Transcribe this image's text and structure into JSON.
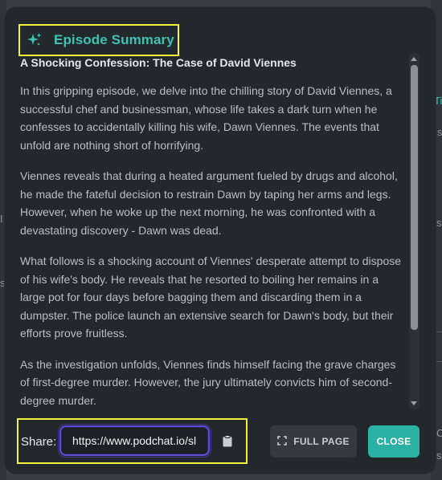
{
  "background": {
    "fragments": [
      "s",
      "I",
      "s",
      "s",
      "C",
      "Ti",
      "s"
    ]
  },
  "modal": {
    "title": "Episode Summary",
    "title_icon": "sparkles-icon",
    "content_title": "A Shocking Confession: The Case of David Viennes",
    "paragraphs": [
      "In this gripping episode, we delve into the chilling story of David Viennes, a successful chef and businessman, whose life takes a dark turn when he confesses to accidentally killing his wife, Dawn Viennes. The events that unfold are nothing short of horrifying.",
      "Viennes reveals that during a heated argument fueled by drugs and alcohol, he made the fateful decision to restrain Dawn by taping her arms and legs. However, when he woke up the next morning, he was confronted with a devastating discovery - Dawn was dead.",
      "What follows is a shocking account of Viennes' desperate attempt to dispose of his wife's body. He reveals that he resorted to boiling her remains in a large pot for four days before bagging them and discarding them in a dumpster. The police launch an extensive search for Dawn's body, but their efforts prove fruitless.",
      "As the investigation unfolds, Viennes finds himself facing the grave charges of first-degree murder. However, the jury ultimately convicts him of second-degree murder."
    ],
    "share": {
      "label": "Share:",
      "url": "https://www.podchat.io/sl",
      "copy_icon": "clipboard-icon"
    },
    "buttons": {
      "full_page": "FULL PAGE",
      "full_page_icon": "expand-icon",
      "close": "CLOSE"
    }
  },
  "colors": {
    "accent": "#2ab1a3",
    "title": "#3ec2b2",
    "modal_bg": "#23282d",
    "focus_ring": "#5a4fd6"
  }
}
